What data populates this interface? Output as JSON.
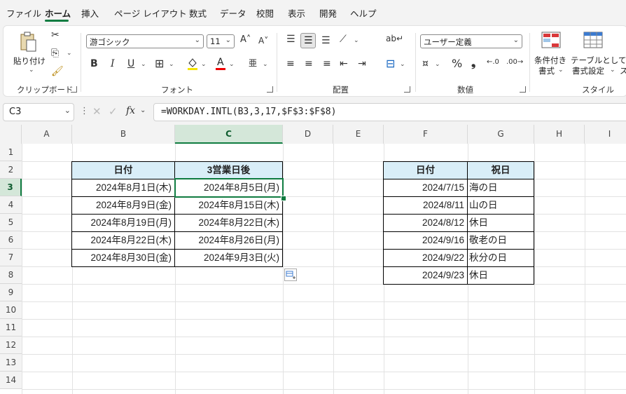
{
  "menu": {
    "items": [
      "ファイル",
      "ホーム",
      "挿入",
      "ページ レイアウト",
      "数式",
      "データ",
      "校閲",
      "表示",
      "開発",
      "ヘルプ"
    ],
    "active": "ホーム"
  },
  "ribbon": {
    "clipboard": {
      "paste_label": "貼り付け",
      "group_label": "クリップボード"
    },
    "font": {
      "font_name": "游ゴシック",
      "font_size": "11",
      "bold": "B",
      "italic": "I",
      "underline": "U",
      "grow": "A˄",
      "shrink": "A˅",
      "font_color_glyph": "A",
      "phonetic": "亜",
      "group_label": "フォント"
    },
    "alignment": {
      "group_label": "配置"
    },
    "number": {
      "format": "ユーザー定義",
      "percent": "%",
      "comma": "❟",
      "group_label": "数値"
    },
    "styles": {
      "conditional_label_1": "条件付き",
      "conditional_label_2": "書式",
      "table_label_1": "テーブルとして",
      "table_label_2": "書式設定",
      "cell_styles_label": "ス",
      "group_label": "スタイル"
    }
  },
  "formula_bar": {
    "name_box": "C3",
    "fx": "fx",
    "formula": "=WORKDAY.INTL(B3,3,17,$F$3:$F$8)"
  },
  "sheet": {
    "columns": [
      "A",
      "B",
      "C",
      "D",
      "E",
      "F",
      "G",
      "H",
      "I"
    ],
    "rows": [
      "1",
      "2",
      "3",
      "4",
      "5",
      "6",
      "7",
      "8",
      "9",
      "10",
      "11",
      "12",
      "13",
      "14"
    ],
    "selected_cell": "C3",
    "table1": {
      "headers": [
        "日付",
        "3営業日後"
      ],
      "rows": [
        [
          "2024年8月1日(木)",
          "2024年8月5日(月)"
        ],
        [
          "2024年8月9日(金)",
          "2024年8月15日(木)"
        ],
        [
          "2024年8月19日(月)",
          "2024年8月22日(木)"
        ],
        [
          "2024年8月22日(木)",
          "2024年8月26日(月)"
        ],
        [
          "2024年8月30日(金)",
          "2024年9月3日(火)"
        ]
      ]
    },
    "table2": {
      "headers": [
        "日付",
        "祝日"
      ],
      "rows": [
        [
          "2024/7/15",
          "海の日"
        ],
        [
          "2024/8/11",
          "山の日"
        ],
        [
          "2024/8/12",
          "休日"
        ],
        [
          "2024/9/16",
          "敬老の日"
        ],
        [
          "2024/9/22",
          "秋分の日"
        ],
        [
          "2024/9/23",
          "休日"
        ]
      ]
    }
  },
  "colors": {
    "accent": "#107c41",
    "header_fill": "#d9eef8"
  }
}
